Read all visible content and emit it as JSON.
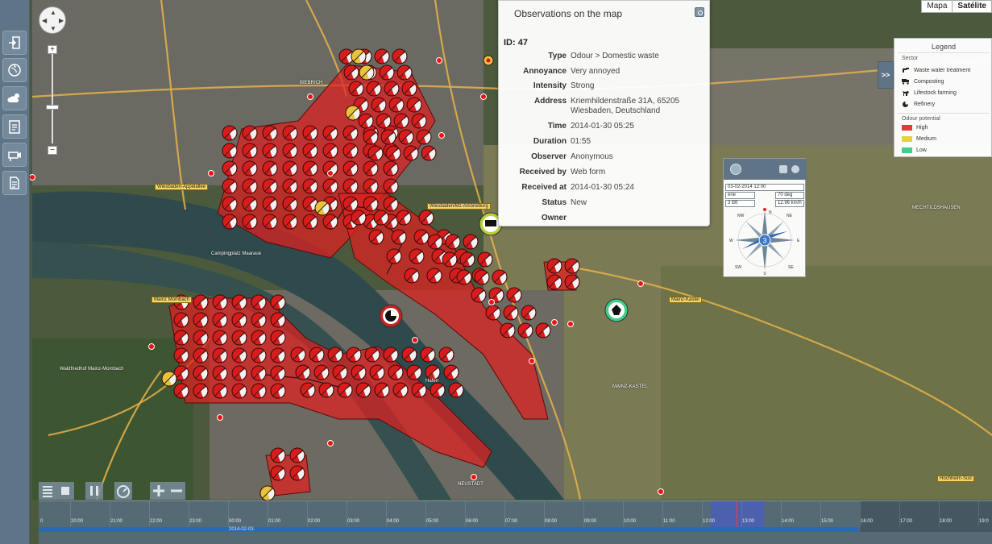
{
  "map_type": {
    "map_label": "Mapa",
    "satellite_label": "Satélite"
  },
  "place_labels": [
    {
      "name": "BIEBRICH"
    },
    {
      "name": "Wiesbaden-Äppelallee"
    },
    {
      "name": "Mainz Mombach"
    },
    {
      "name": "Mainz-Kastel"
    },
    {
      "name": "Hochheim-Süd"
    },
    {
      "name": "MECHTILDSHAUSEN"
    },
    {
      "name": "NEUSTADT"
    },
    {
      "name": "Wiesbaden/Mz-Amöneburg"
    },
    {
      "name": "Waldfriedhof Mainz-Mombach"
    },
    {
      "name": "Campingplatz Maaraue"
    },
    {
      "name": "Hafen"
    },
    {
      "name": "MAINZ-KASTEL"
    }
  ],
  "popup": {
    "title": "Observations on the map",
    "id_text": "ID: 47",
    "rows": [
      {
        "label": "Type",
        "value": "Odour > Domestic waste"
      },
      {
        "label": "Annoyance",
        "value": "Very annoyed"
      },
      {
        "label": "Intensity",
        "value": "Strong"
      },
      {
        "label": "Address",
        "value": "Kriemhildenstraße 31A, 65205 Wiesbaden, Deutschland"
      },
      {
        "label": "Time",
        "value": "2014-01-30 05:25"
      },
      {
        "label": "Duration",
        "value": "01:55"
      },
      {
        "label": "Observer",
        "value": "Anonymous"
      },
      {
        "label": "Received by",
        "value": "Web form"
      },
      {
        "label": "Received at",
        "value": "2014-01-30 05:24"
      },
      {
        "label": "Status",
        "value": "New"
      },
      {
        "label": "Owner",
        "value": ""
      }
    ]
  },
  "legend": {
    "toggle_label": ">>",
    "title": "Legend",
    "sector_heading": "Sector",
    "sectors": [
      {
        "label": "Waste water treatment",
        "icon": "tap-icon"
      },
      {
        "label": "Composting",
        "icon": "truck-icon"
      },
      {
        "label": "Lifestock farming",
        "icon": "cow-icon"
      },
      {
        "label": "Refinery",
        "icon": "refinery-icon"
      }
    ],
    "potential_heading": "Odour potential",
    "potentials": [
      {
        "label": "High",
        "color": "#e23b3b"
      },
      {
        "label": "Medium",
        "color": "#e6d13f"
      },
      {
        "label": "Low",
        "color": "#3fcf8a"
      }
    ]
  },
  "wind": {
    "datetime": "03-02-2014 12:00",
    "direction_name": "ene",
    "direction_deg": "70 deg",
    "beaufort": "3 Bft",
    "speed": "12.96 km/h",
    "compass_value": "3",
    "compass_labels": {
      "n": "N",
      "ne": "NE",
      "e": "E",
      "se": "SE",
      "s": "S",
      "sw": "SW",
      "w": "W",
      "nw": "NW"
    }
  },
  "timeline": {
    "ticks": [
      "20:00",
      "21:00",
      "22:00",
      "23:00",
      "00:00",
      "01:00",
      "02:00",
      "03:00",
      "04:00",
      "05:00",
      "06:00",
      "07:00",
      "08:00",
      "09:00",
      "10:00",
      "11:00",
      "12:00",
      "13:00",
      "14:00",
      "15:00",
      "16:00",
      "17:00",
      "18:00",
      "19:0"
    ],
    "start_tick": "0",
    "date": "2014-02-03"
  },
  "colors": {
    "high": "#e21f1f",
    "medium": "#e8c33a",
    "low": "#3fcf8a",
    "sidebar": "#5f7486"
  }
}
